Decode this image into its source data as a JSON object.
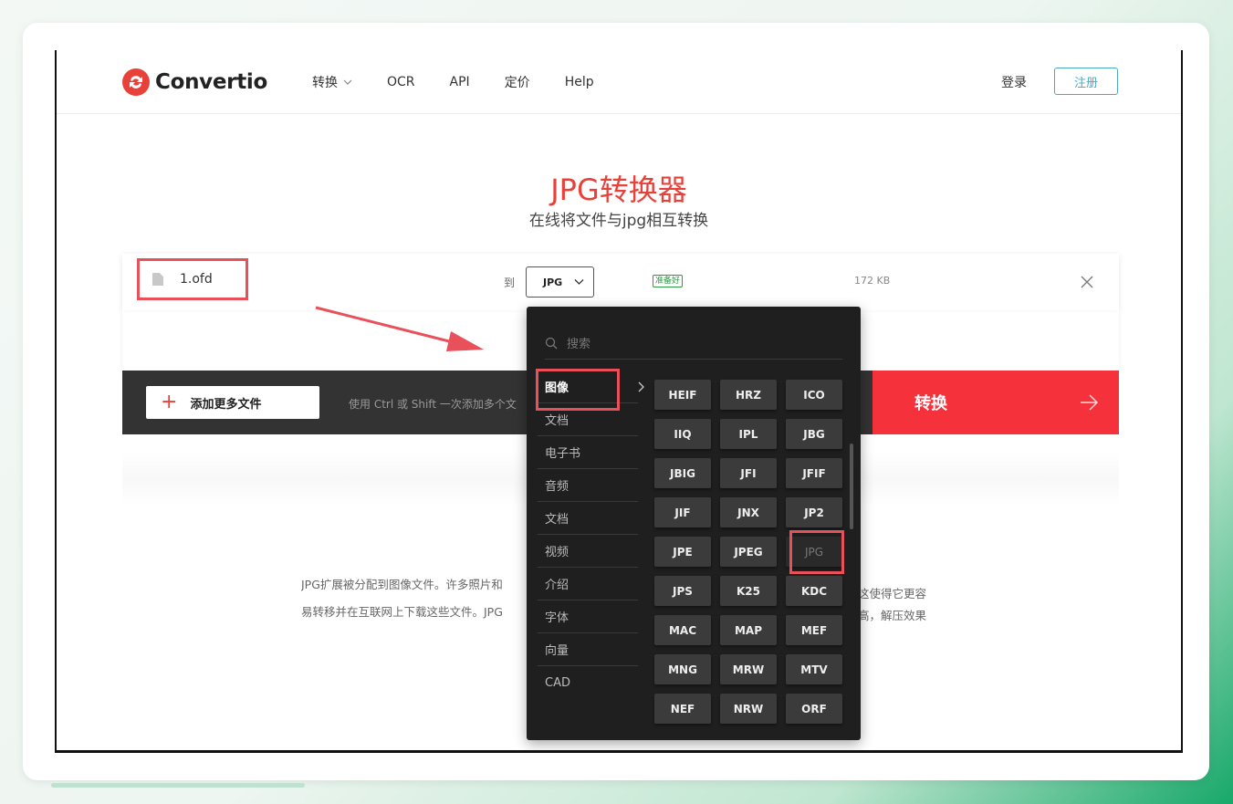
{
  "brand": {
    "name": "Convertio"
  },
  "nav": {
    "items": [
      "转换",
      "OCR",
      "API",
      "定价",
      "Help"
    ]
  },
  "auth": {
    "login": "登录",
    "signup": "注册"
  },
  "hero": {
    "title": "JPG转换器",
    "subtitle": "在线将文件与jpg相互转换"
  },
  "file": {
    "name": "1.ofd",
    "to_label": "到",
    "target_format": "JPG",
    "status": "准备好",
    "size": "172 KB"
  },
  "actions": {
    "add_files": "添加更多文件",
    "hint": "使用 Ctrl 或 Shift 一次添加多个文",
    "convert": "转换"
  },
  "description": {
    "line1_left": "JPG扩展被分配到图像文件。许多照片和",
    "line1_right": "这使得它更容",
    "line2_left": "易转移并在互联网上下载这些文件。JPG",
    "line2_right": "高，解压效果"
  },
  "dropdown": {
    "search_placeholder": "搜索",
    "categories": [
      "图像",
      "文档",
      "电子书",
      "音频",
      "文档",
      "视频",
      "介绍",
      "字体",
      "向量",
      "CAD"
    ],
    "formats": [
      "HEIF",
      "HRZ",
      "ICO",
      "IIQ",
      "IPL",
      "JBG",
      "JBIG",
      "JFI",
      "JFIF",
      "JIF",
      "JNX",
      "JP2",
      "JPE",
      "JPEG",
      "JPG",
      "JPS",
      "K25",
      "KDC",
      "MAC",
      "MAP",
      "MEF",
      "MNG",
      "MRW",
      "MTV",
      "NEF",
      "NRW",
      "ORF"
    ],
    "selected_format": "JPG"
  },
  "colors": {
    "brand_red": "#e8413a",
    "convert_red": "#f5323b",
    "accent_blue": "#4aa8c9",
    "highlight_box": "#e8515a"
  }
}
